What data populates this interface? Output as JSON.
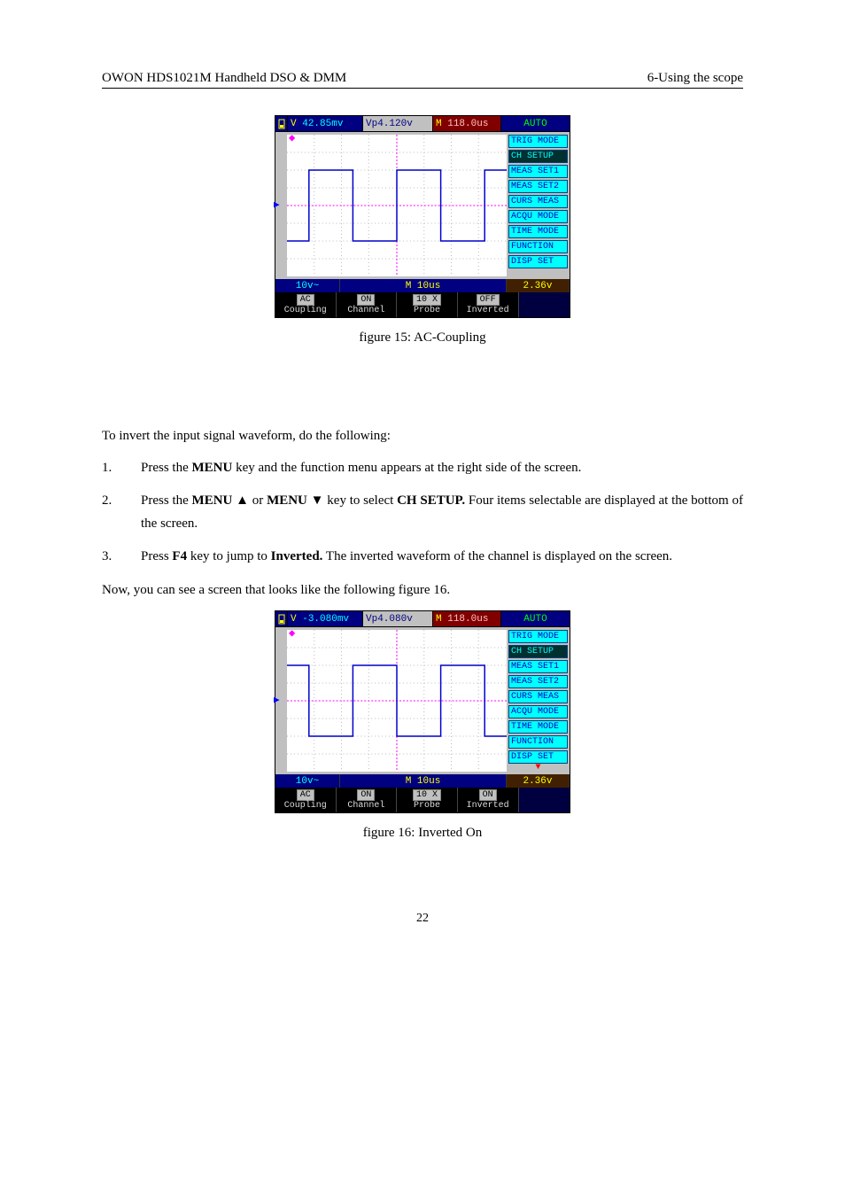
{
  "header": {
    "left": "OWON    HDS1021M Handheld DSO & DMM",
    "right": "6-Using the scope"
  },
  "figures": {
    "fig15": {
      "caption": "figure 15: AC-Coupling",
      "top": {
        "v_label": "V",
        "v_value": "42.85mv",
        "vp_value": "Vp4.120v",
        "m_label": "M",
        "m_value": "118.0us",
        "mode": "AUTO"
      },
      "menu": [
        "TRIG MODE",
        "CH SETUP",
        "MEAS SET1",
        "MEAS SET2",
        "CURS MEAS",
        "ACQU MODE",
        "TIME MODE",
        "FUNCTION",
        "DISP SET"
      ],
      "menu_active_index": 1,
      "mid": {
        "vdiv": "10v~",
        "timebase": "M 10us",
        "trig": "2.36v"
      },
      "bottom": {
        "coupling_val": "AC",
        "coupling_lbl": "Coupling",
        "channel_val": "ON",
        "channel_lbl": "Channel",
        "probe_val": "10 X",
        "probe_lbl": "Probe",
        "inverted_val": "OFF",
        "inverted_lbl": "Inverted"
      }
    },
    "fig16": {
      "caption": "figure 16: Inverted On",
      "top": {
        "v_label": "V",
        "v_value": "-3.080mv",
        "vp_value": "Vp4.080v",
        "m_label": "M",
        "m_value": "118.0us",
        "mode": "AUTO"
      },
      "menu": [
        "TRIG MODE",
        "CH SETUP",
        "MEAS SET1",
        "MEAS SET2",
        "CURS MEAS",
        "ACQU MODE",
        "TIME MODE",
        "FUNCTION",
        "DISP SET"
      ],
      "menu_active_index": 1,
      "mid": {
        "vdiv": "10v~",
        "timebase": "M 10us",
        "trig": "2.36v"
      },
      "bottom": {
        "coupling_val": "AC",
        "coupling_lbl": "Coupling",
        "channel_val": "ON",
        "channel_lbl": "Channel",
        "probe_val": "10 X",
        "probe_lbl": "Probe",
        "inverted_val": "ON",
        "inverted_lbl": "Inverted"
      }
    }
  },
  "text": {
    "intro": "To invert the input signal waveform, do the following:",
    "step1": "Press the MENU key and the function menu appears at the right side of the screen.",
    "step2a": "Press the ",
    "step2b": "MENU ▲",
    "step2c": " or ",
    "step2d": "MENU ▼",
    "step2e": " key to select ",
    "step2f": "CH SETUP.",
    "step2g": " Four items selectable are displayed at the bottom of the screen.",
    "step3a": "Press ",
    "step3b": "F4",
    "step3c": " key to jump to ",
    "step3d": "Inverted.",
    "step3e": " The inverted waveform of the channel is displayed on the screen.",
    "outro": "Now, you can see a screen that looks like the following figure 16."
  },
  "keys": {
    "menu": "MENU"
  },
  "page_number": "22"
}
